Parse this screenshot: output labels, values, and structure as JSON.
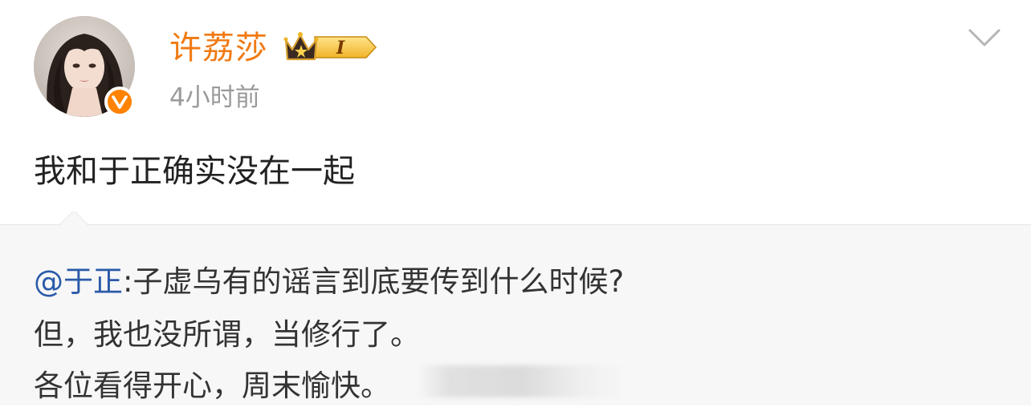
{
  "post": {
    "author": {
      "name": "许荔莎",
      "verified": true,
      "vip_level": "I"
    },
    "timestamp": "4小时前",
    "text": "我和于正确实没在一起"
  },
  "repost": {
    "mention": "@于正",
    "line1_rest": ":子虚乌有的谣言到底要传到什么时候?",
    "line2": "但，我也没所谓，当修行了。",
    "line3": "各位看得开心，周末愉快。"
  },
  "colors": {
    "username": "#f07a12",
    "verified_badge": "#ff8200",
    "mention": "#2a5aa8",
    "repost_bg": "#f7f7f7"
  },
  "icons": {
    "menu": "chevron-down-icon",
    "verified": "verified-v-icon",
    "vip": "crown-vip-icon"
  }
}
